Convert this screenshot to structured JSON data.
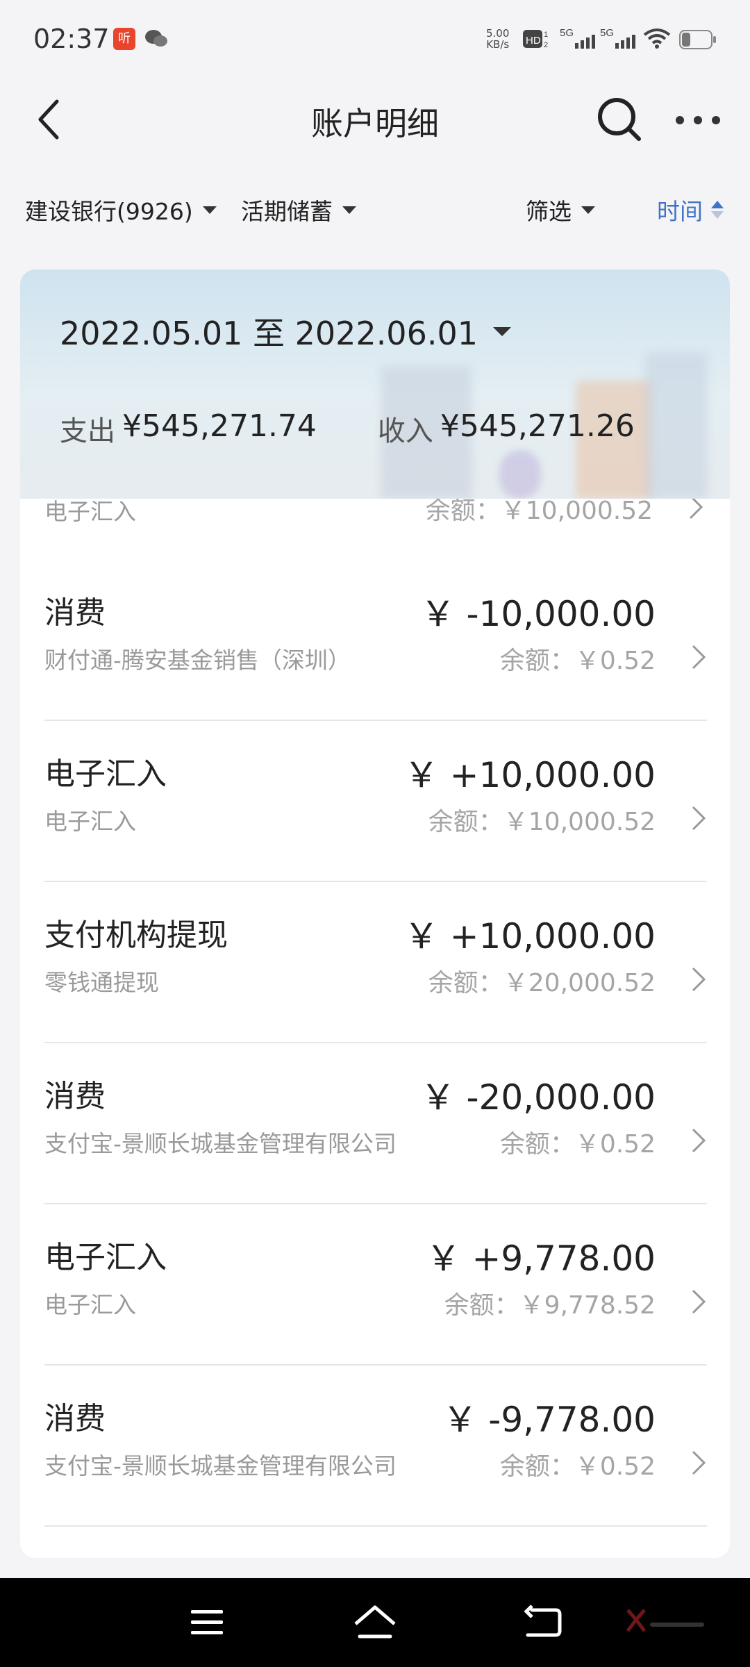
{
  "status_bar": {
    "time": "02:37",
    "app_badge": "听",
    "net_speed_value": "5.00",
    "net_speed_unit": "KB/s",
    "network": "5G",
    "network2": "5G",
    "icons": [
      "listen-app-icon",
      "wechat-icon",
      "hd-voice-icon",
      "signal-icon",
      "signal-icon",
      "wifi-icon",
      "battery-icon"
    ]
  },
  "header": {
    "title": "账户明细",
    "icons": [
      "back-icon",
      "search-icon",
      "more-icon"
    ]
  },
  "filters": {
    "bank": "建设银行(9926)",
    "account_type": "活期储蓄",
    "filter": "筛选",
    "sort": "时间",
    "accent_color": "#3f73c9"
  },
  "summary": {
    "date_range": "2022.05.01 至 2022.06.01",
    "expense_label": "支出",
    "expense_value": "¥545,271.74",
    "income_label": "收入",
    "income_value": "¥545,271.26"
  },
  "partial_row": {
    "sub": "电子汇入",
    "balance": "余额：￥10,000.52"
  },
  "transactions": [
    {
      "title": "消费",
      "sub": "财付通-腾安基金销售（深圳）",
      "amount": "￥ -10,000.00",
      "balance": "余额：￥0.52"
    },
    {
      "title": "电子汇入",
      "sub": "电子汇入",
      "amount": "￥ +10,000.00",
      "balance": "余额：￥10,000.52"
    },
    {
      "title": "支付机构提现",
      "sub": "零钱通提现",
      "amount": "￥ +10,000.00",
      "balance": "余额：￥20,000.52"
    },
    {
      "title": "消费",
      "sub": "支付宝-景顺长城基金管理有限公司",
      "amount": "￥ -20,000.00",
      "balance": "余额：￥0.52"
    },
    {
      "title": "电子汇入",
      "sub": "电子汇入",
      "amount": "￥ +9,778.00",
      "balance": "余额：￥9,778.52"
    },
    {
      "title": "消费",
      "sub": "支付宝-景顺长城基金管理有限公司",
      "amount": "￥ -9,778.00",
      "balance": "余额：￥0.52"
    }
  ],
  "nav_bar": {
    "icons": [
      "menu-icon",
      "home-icon",
      "back-nav-icon"
    ]
  }
}
